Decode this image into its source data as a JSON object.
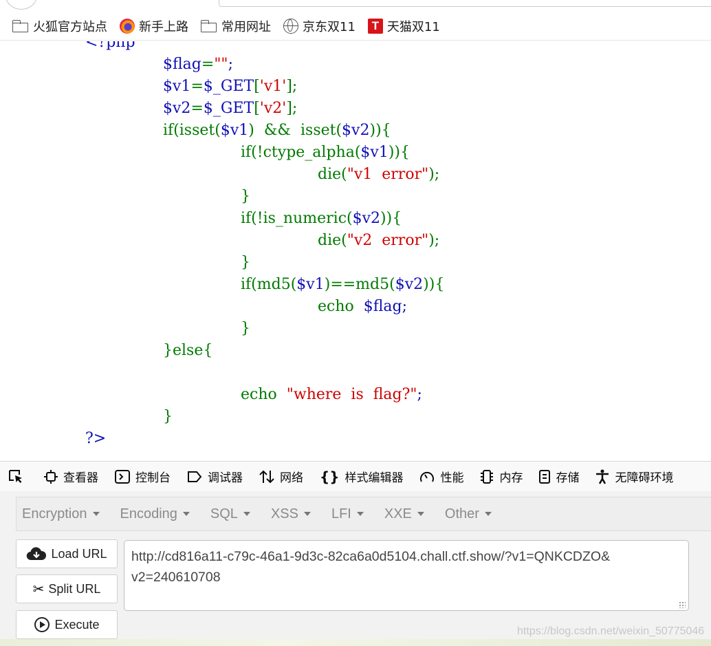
{
  "bookmarks": [
    {
      "label": "火狐官方站点",
      "icon": "folder-icon"
    },
    {
      "label": "新手上路",
      "icon": "firefox-icon"
    },
    {
      "label": "常用网址",
      "icon": "folder-icon"
    },
    {
      "label": "京东双11",
      "icon": "globe-icon"
    },
    {
      "label": "天猫双11",
      "icon": "tmall-icon"
    }
  ],
  "code": {
    "open_tag": "<?php",
    "l1_var": "$flag",
    "l1_eq": "=",
    "l1_str": "\"\"",
    "l1_end": ";",
    "l2_var": "$v1",
    "l2_eq": "=",
    "l2_get": "$_GET",
    "l2_b1": "[",
    "l2_key": "'v1'",
    "l2_b2": "];",
    "l3_var": "$v2",
    "l3_eq": "=",
    "l3_get": "$_GET",
    "l3_b1": "[",
    "l3_key": "'v2'",
    "l3_b2": "];",
    "l4_a": "if(isset(",
    "l4_b": "$v1",
    "l4_c": ")  &&  isset(",
    "l4_d": "$v2",
    "l4_e": ")){",
    "l5_a": "if(!ctype_alpha(",
    "l5_b": "$v1",
    "l5_c": ")){",
    "l6_a": "die(",
    "l6_b": "\"v1  error\"",
    "l6_c": ");",
    "l7": "}",
    "l8_a": "if(!is_numeric(",
    "l8_b": "$v2",
    "l8_c": ")){",
    "l9_a": "die(",
    "l9_b": "\"v2  error\"",
    "l9_c": ");",
    "l10": "}",
    "l11_a": "if(md5(",
    "l11_b": "$v1",
    "l11_c": ")==md5(",
    "l11_d": "$v2",
    "l11_e": ")){",
    "l12_a": "echo  ",
    "l12_b": "$flag",
    "l12_c": ";",
    "l13": "}",
    "l14": "}else{",
    "l15_a": "echo  ",
    "l15_b": "\"where  is  flag?\"",
    "l15_c": ";",
    "l16": "}",
    "close_tag": "?>"
  },
  "devtools": {
    "inspector": "查看器",
    "console": "控制台",
    "debugger": "调试器",
    "network": "网络",
    "style_editor": "样式编辑器",
    "performance": "性能",
    "memory": "内存",
    "storage": "存储",
    "accessibility": "无障碍环境"
  },
  "hackbar": {
    "menu": [
      "Encryption",
      "Encoding",
      "SQL",
      "XSS",
      "LFI",
      "XXE",
      "Other"
    ],
    "load_url": "Load URL",
    "split_url": "Split URL",
    "execute": "Execute",
    "url_value": "http://cd816a11-c79c-46a1-9d3c-82ca6a0d5104.chall.ctf.show/?v1=QNKCDZO&\nv2=240610708"
  },
  "watermark": "https://blog.csdn.net/weixin_50775046",
  "colors": {
    "keyword_green": "#007a00",
    "variable_blue": "#1010b8",
    "string_red": "#d00000"
  }
}
